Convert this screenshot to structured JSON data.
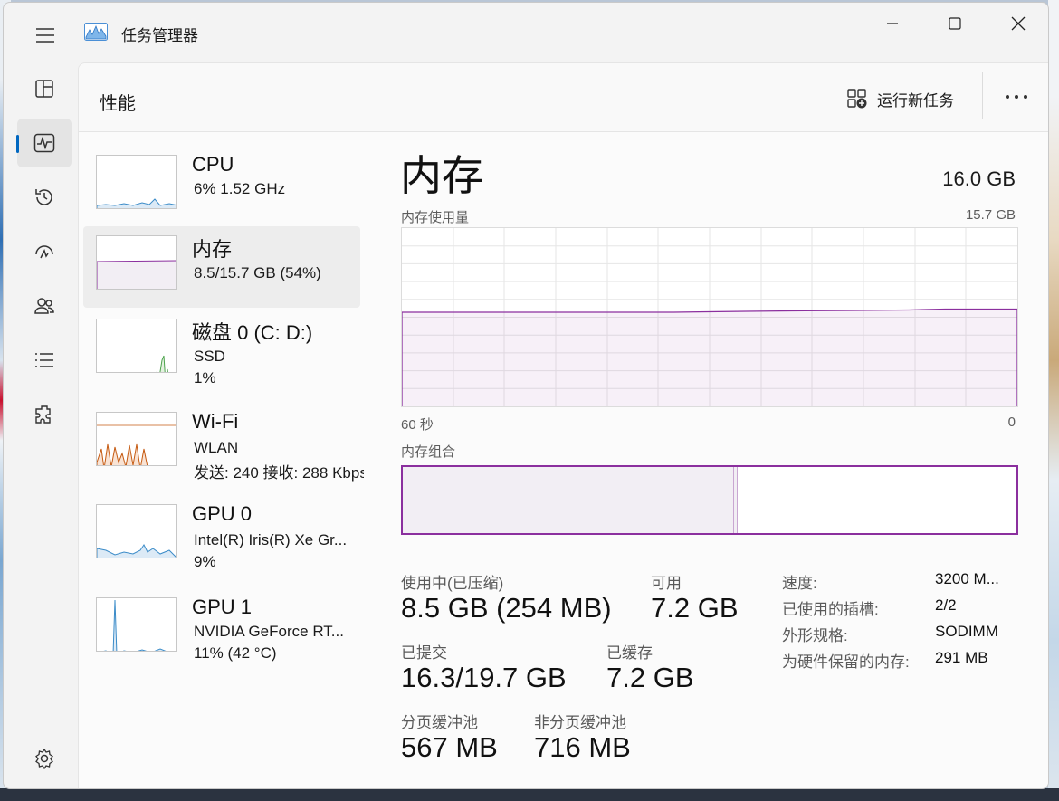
{
  "window": {
    "title": "任务管理器"
  },
  "header": {
    "page_title": "性能",
    "run_new_task": "运行新任务"
  },
  "nav": [
    "processes-icon",
    "performance-icon",
    "app-history-icon",
    "startup-apps-icon",
    "users-icon",
    "details-icon",
    "services-icon",
    "settings-icon"
  ],
  "resources": [
    {
      "name": "CPU",
      "line1": "6%  1.52 GHz",
      "line2": ""
    },
    {
      "name": "内存",
      "line1": "8.5/15.7 GB (54%)",
      "line2": ""
    },
    {
      "name": "磁盘 0 (C: D:)",
      "line1": "SSD",
      "line2": "1%"
    },
    {
      "name": "Wi-Fi",
      "line1": "WLAN",
      "line2": "发送: 240  接收: 288 Kbps"
    },
    {
      "name": "GPU 0",
      "line1": "Intel(R) Iris(R) Xe Gr...",
      "line2": "9%"
    },
    {
      "name": "GPU 1",
      "line1": "NVIDIA GeForce RT...",
      "line2": "11% (42 °C)"
    }
  ],
  "detail": {
    "title": "内存",
    "total": "16.0 GB",
    "usage_label": "内存使用量",
    "usage_max": "15.7 GB",
    "axis_left": "60 秒",
    "axis_right": "0",
    "composition_label": "内存组合",
    "in_use_fraction": 0.54,
    "stats": {
      "in_use_label": "使用中(已压缩)",
      "in_use_value": "8.5 GB (254 MB)",
      "available_label": "可用",
      "available_value": "7.2 GB",
      "committed_label": "已提交",
      "committed_value": "16.3/19.7 GB",
      "cached_label": "已缓存",
      "cached_value": "7.2 GB",
      "paged_label": "分页缓冲池",
      "paged_value": "567 MB",
      "nonpaged_label": "非分页缓冲池",
      "nonpaged_value": "716 MB"
    },
    "kv": [
      {
        "label": "速度:",
        "value": "3200 M..."
      },
      {
        "label": "已使用的插槽:",
        "value": "2/2"
      },
      {
        "label": "外形规格:",
        "value": "SODIMM"
      },
      {
        "label": "为硬件保留的内存:",
        "value": "291 MB"
      }
    ]
  },
  "colors": {
    "accent": "#0067c0",
    "memory": "#8b2f9e",
    "memory_fill": "#f2eef4",
    "cpu": "#3a8bc8",
    "disk": "#4da34d",
    "wifi": "#c55a11",
    "gpu": "#3a8bc8"
  }
}
